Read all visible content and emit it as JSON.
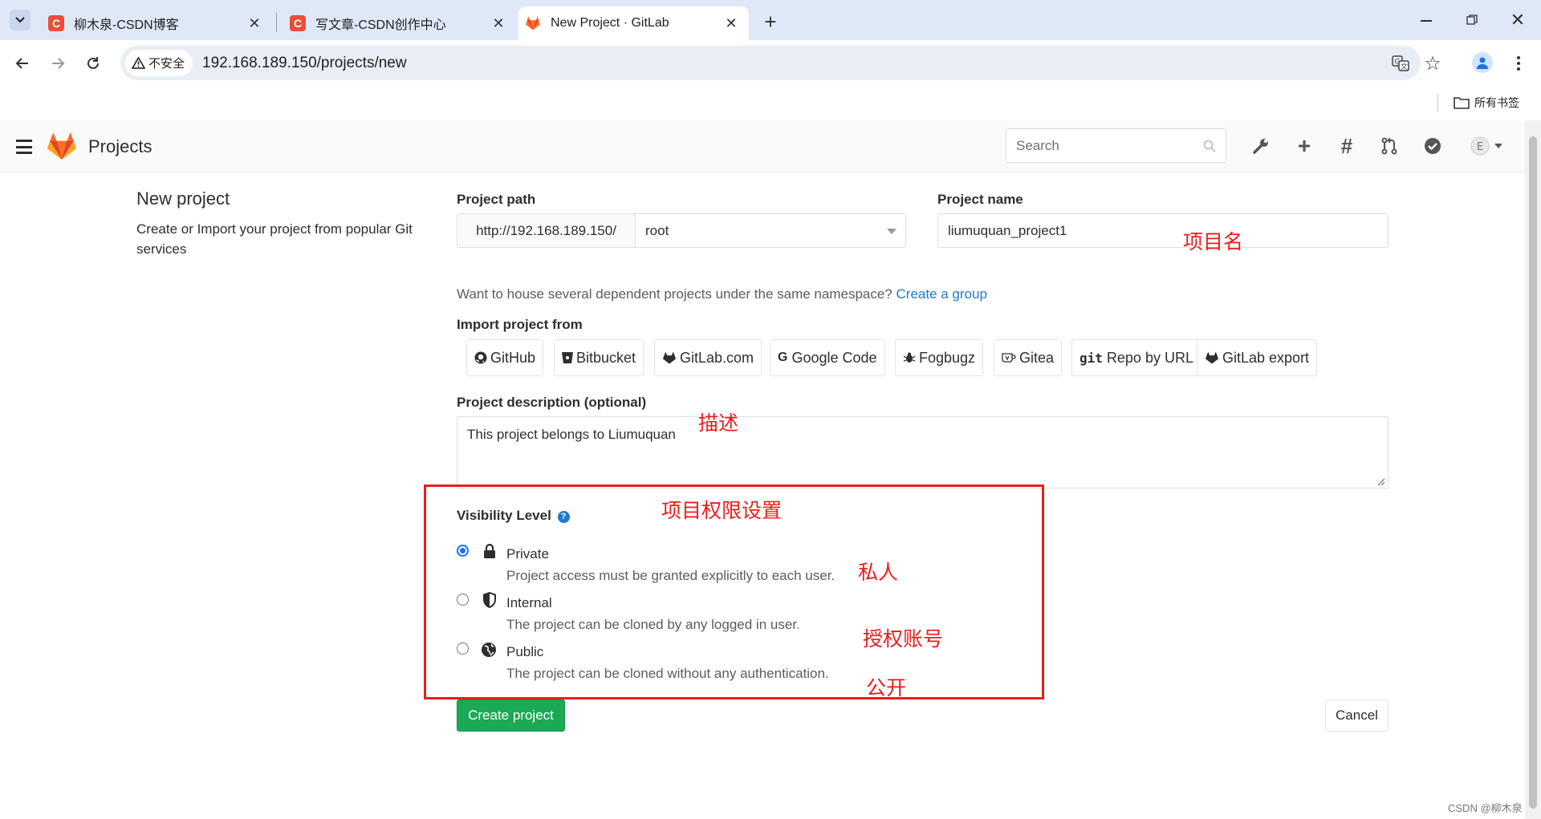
{
  "browser": {
    "tabs": [
      {
        "title": "柳木泉-CSDN博客",
        "favicon": "C"
      },
      {
        "title": "写文章-CSDN创作中心",
        "favicon": "C"
      },
      {
        "title": "New Project · GitLab",
        "favicon": "gitlab-icon"
      }
    ],
    "security_badge": "不安全",
    "url": "192.168.189.150/projects/new",
    "bookmarks_label": "所有书签"
  },
  "header": {
    "brand": "Projects",
    "search_placeholder": "Search"
  },
  "sidebar": {
    "title": "New project",
    "description": "Create or Import your project from popular Git services"
  },
  "form": {
    "project_path_label": "Project path",
    "path_prefix": "http://192.168.189.150/",
    "namespace": "root",
    "project_name_label": "Project name",
    "project_name_value": "liumuquan_project1",
    "group_hint": "Want to house several dependent projects under the same namespace?",
    "create_group_link": "Create a group",
    "import_label": "Import project from",
    "import_sources": [
      {
        "label": "GitHub",
        "icon": "github-icon"
      },
      {
        "label": "Bitbucket",
        "icon": "bitbucket-icon"
      },
      {
        "label": "GitLab.com",
        "icon": "gitlab-icon"
      },
      {
        "label": "Google Code",
        "icon": "google-icon"
      },
      {
        "label": "Fogbugz",
        "icon": "bug-icon"
      },
      {
        "label": "Gitea",
        "icon": "gitea-icon"
      },
      {
        "label": "Repo by URL",
        "icon": "git-icon"
      },
      {
        "label": "GitLab export",
        "icon": "gitlab-icon"
      }
    ],
    "description_label": "Project description (optional)",
    "description_value": "This project belongs to Liumuquan",
    "visibility_label": "Visibility Level",
    "visibility_options": [
      {
        "title": "Private",
        "desc": "Project access must be granted explicitly to each user.",
        "icon": "lock-icon",
        "selected": true
      },
      {
        "title": "Internal",
        "desc": "The project can be cloned by any logged in user.",
        "icon": "shield-icon",
        "selected": false
      },
      {
        "title": "Public",
        "desc": "The project can be cloned without any authentication.",
        "icon": "globe-icon",
        "selected": false
      }
    ],
    "create_button": "Create project",
    "cancel_button": "Cancel"
  },
  "annotations": {
    "project_name": "项目名",
    "description": "描述",
    "visibility": "项目权限设置",
    "private": "私人",
    "internal": "授权账号",
    "public": "公开"
  },
  "watermark": "CSDN @柳木泉",
  "colors": {
    "accent_green": "#1aaa55",
    "annotation_red": "#ee1c1c",
    "link_blue": "#1f78d1"
  }
}
